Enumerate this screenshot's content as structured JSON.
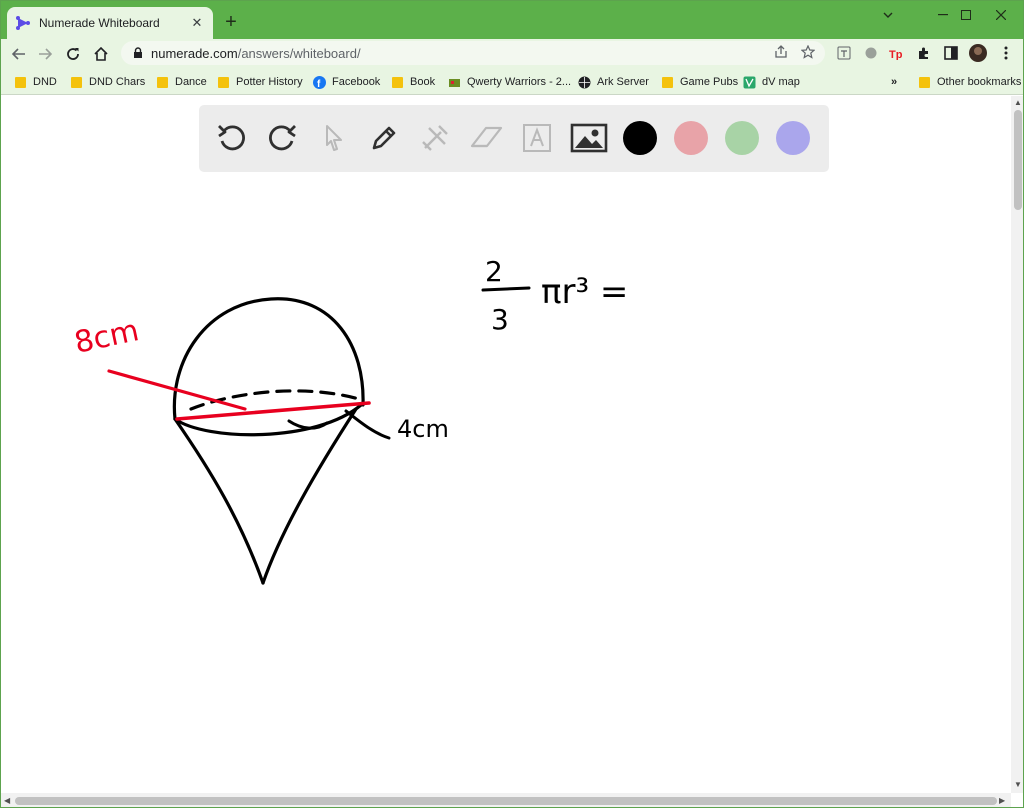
{
  "browser": {
    "tab": {
      "title": "Numerade Whiteboard",
      "close": "✕",
      "new_tab": "+"
    },
    "window_controls": {
      "minimize": "⌵",
      "restore": "—",
      "maximize": "☐",
      "close": "✕"
    },
    "url": {
      "host": "numerade.com",
      "path": "/answers/whiteboard/"
    },
    "bookmarks": [
      {
        "label": "DND",
        "icon": "folder-icon"
      },
      {
        "label": "DND Chars",
        "icon": "folder-icon"
      },
      {
        "label": "Dance",
        "icon": "folder-icon"
      },
      {
        "label": "Potter History",
        "icon": "folder-icon"
      },
      {
        "label": "Facebook",
        "icon": "facebook-icon"
      },
      {
        "label": "Book",
        "icon": "folder-icon"
      },
      {
        "label": "Qwerty Warriors - 2...",
        "icon": "game-icon"
      },
      {
        "label": "Ark Server",
        "icon": "globe-icon"
      },
      {
        "label": "Game Pubs",
        "icon": "folder-icon"
      },
      {
        "label": "dV map",
        "icon": "map-icon"
      }
    ],
    "bookmarks_overflow": "»",
    "other_bookmarks": "Other bookmarks",
    "extensions": [
      "calculator-icon",
      "circle-icon",
      "tp-icon",
      "puzzle-icon",
      "sidebar-icon",
      "avatar",
      "menu-icon"
    ]
  },
  "whiteboard": {
    "tools": [
      "undo-icon",
      "redo-icon",
      "select-icon",
      "pen-icon",
      "tools-icon",
      "eraser-icon",
      "text-icon",
      "image-icon"
    ],
    "colors": [
      "#000000",
      "#e8a3a8",
      "#a8d3a6",
      "#aaa6ec"
    ],
    "annotations": {
      "diameter": "8cm",
      "height": "4cm",
      "formula_numerator": "2",
      "formula_denominator": "3",
      "formula_rest": "πr³ ="
    },
    "ink": {
      "black": "#000000",
      "red": "#e8001f"
    }
  }
}
